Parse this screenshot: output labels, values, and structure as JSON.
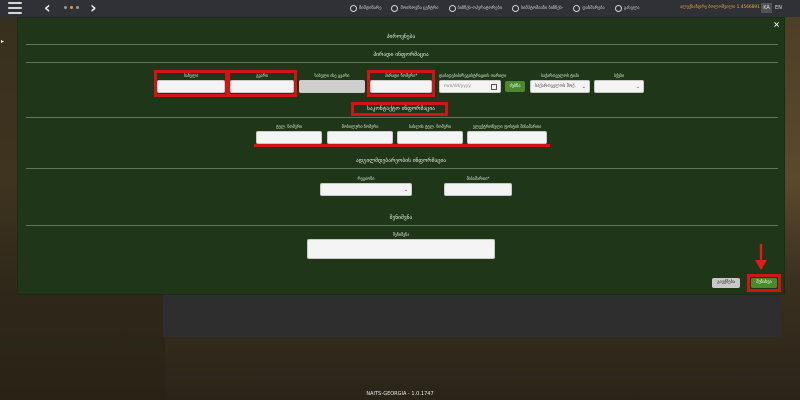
{
  "topbar": {
    "menu": [
      {
        "label": "მიმდინარე",
        "icon": "home-icon"
      },
      {
        "label": "მოთხოვნა ცენტრი",
        "icon": "request-icon"
      },
      {
        "label": "ბიზნეს-ოპერატორები",
        "icon": "business-icon"
      },
      {
        "label": "სიმპტომიანი ბიზნეს-",
        "icon": "report-icon"
      },
      {
        "label": "დახმარება",
        "icon": "help-icon"
      },
      {
        "label": "გასვლა",
        "icon": "logout-icon"
      }
    ],
    "user": "ალექსანდრე ბოლოშვილი 1.4566891",
    "lang_ka": "KA",
    "lang_en": "EN"
  },
  "modal": {
    "title": "პიროვნება",
    "close": "×",
    "personal": {
      "title": "პირადი ინფორმაცია",
      "first_name_label": "სახელი",
      "last_name_label": "გვარი",
      "patronymic_label": "სახელი ისე გვარი",
      "personal_id_label": "პირადი ნომერი*",
      "birth_date_label": "დაბადების/რეგისტრაციის თარიღი",
      "birth_date_placeholder": "mm/dd/yyyy",
      "search_button": "ძებნა",
      "citizenship_label": "საქართველოს ტიპი",
      "citizenship_value": "საქართველოს მოქ.",
      "gender_label": "სქესი",
      "gender_value": ""
    },
    "contact": {
      "title": "საკონტაქტო ინფორმაცია",
      "phone_label": "ტელ. ნომერი",
      "mobile_label": "მობილური ნომერი",
      "home_phone_label": "სახლის ტელ. ნომერი",
      "email_label": "ელექტრონული ფოსტის მისამართი"
    },
    "location": {
      "title": "ადგილმდებარეობის ინფორმაცია",
      "region_label": "რეგიონი",
      "address_label": "მისამართი*"
    },
    "note": {
      "title": "შენიშვნა",
      "field_label": "შენიშვნა"
    },
    "cancel_button": "გაუქმება",
    "save_button": "შენახვა"
  },
  "footer": "NAITS-GEORGIA - 1.0.1747",
  "colors": {
    "modal_bg": "#1f3718",
    "highlight": "#d11515",
    "accent_orange": "#e8a93a",
    "button_green": "#4a8a2a"
  }
}
